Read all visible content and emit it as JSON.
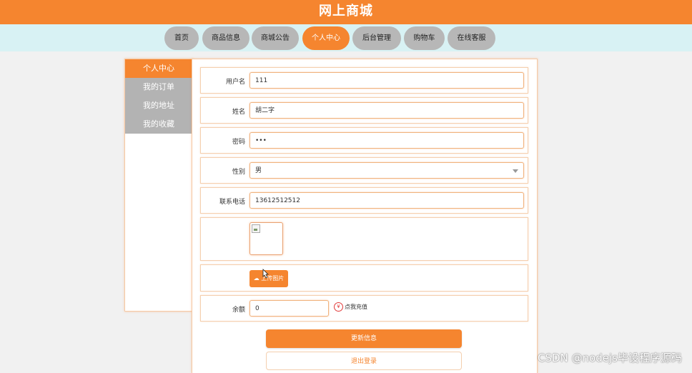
{
  "header": {
    "title": "网上商城"
  },
  "nav": [
    {
      "label": "首页",
      "active": false
    },
    {
      "label": "商品信息",
      "active": false
    },
    {
      "label": "商城公告",
      "active": false
    },
    {
      "label": "个人中心",
      "active": true
    },
    {
      "label": "后台管理",
      "active": false
    },
    {
      "label": "购物车",
      "active": false
    },
    {
      "label": "在线客服",
      "active": false
    }
  ],
  "sidebar": {
    "items": [
      {
        "label": "个人中心",
        "active": true
      },
      {
        "label": "我的订单",
        "active": false
      },
      {
        "label": "我的地址",
        "active": false
      },
      {
        "label": "我的收藏",
        "active": false
      }
    ]
  },
  "form": {
    "username": {
      "label": "用户名",
      "value": "111"
    },
    "name": {
      "label": "姓名",
      "value": "胡二字"
    },
    "password": {
      "label": "密码",
      "value": "•••"
    },
    "gender": {
      "label": "性别",
      "value": "男"
    },
    "phone": {
      "label": "联系电话",
      "value": "13612512512"
    },
    "upload_label": "上传图片",
    "balance": {
      "label": "余额",
      "value": "0"
    },
    "recharge_label": "点我充值",
    "update_button": "更新信息",
    "logout_button": "退出登录"
  },
  "watermark": "CSDN @nodejs毕设程序源码",
  "colors": {
    "accent": "#f5852f",
    "nav_bg": "#d8f2f4",
    "inactive": "#b7b7b7"
  }
}
